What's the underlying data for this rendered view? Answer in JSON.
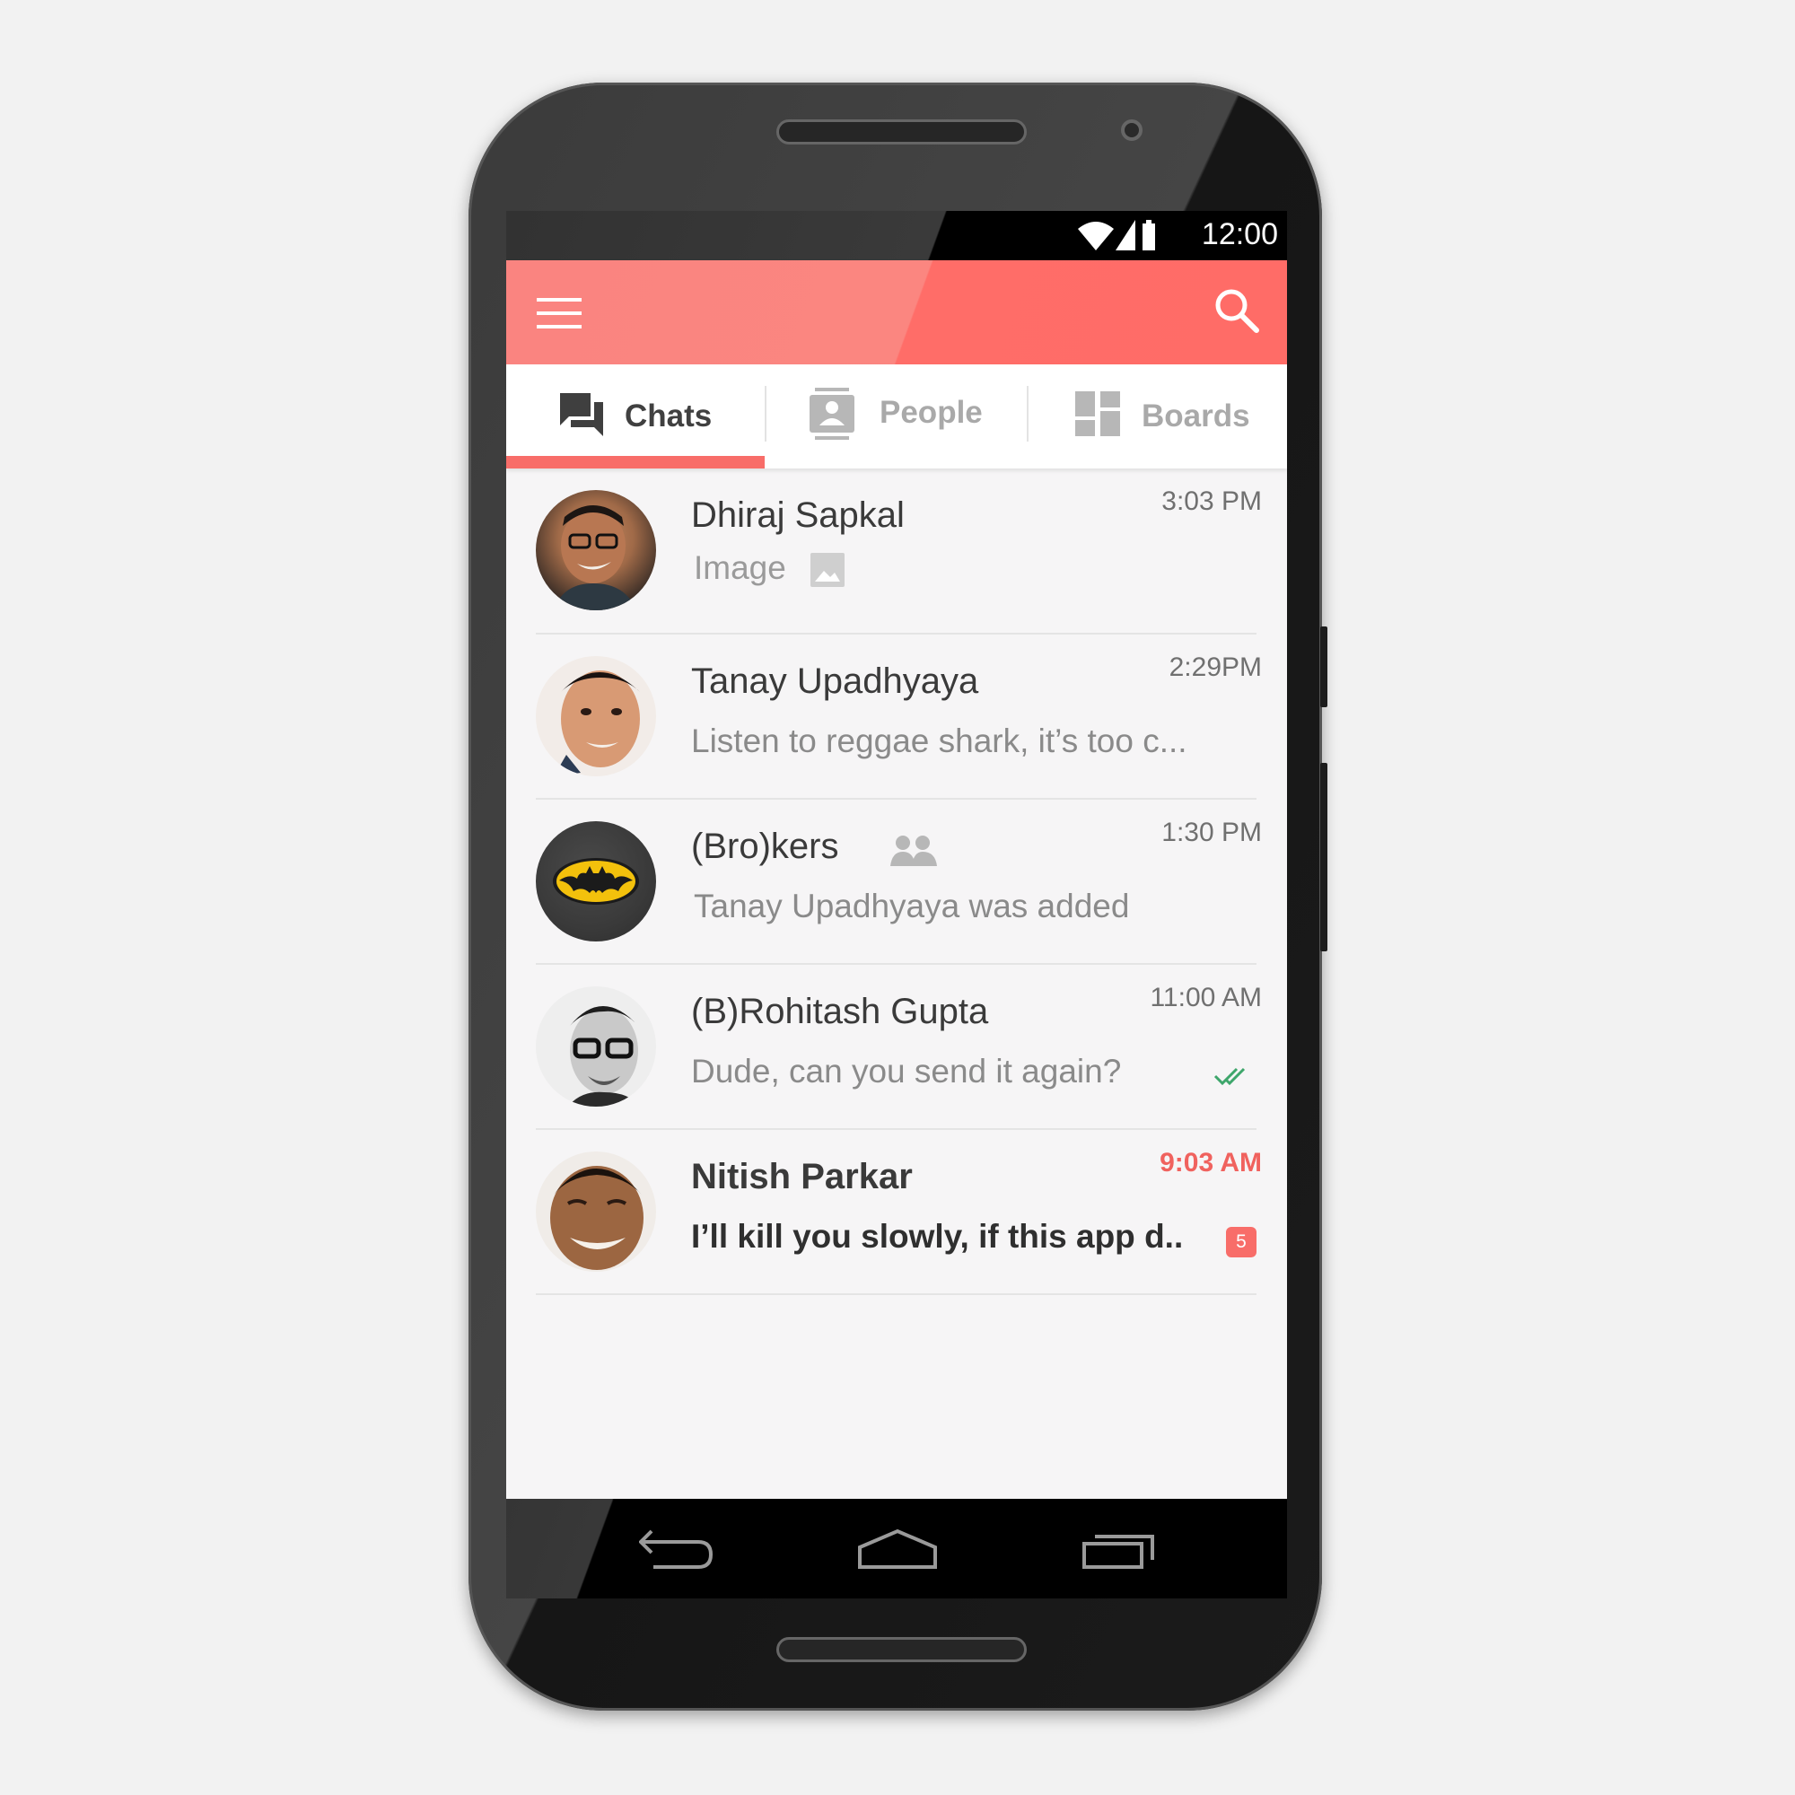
{
  "status_bar": {
    "time": "12:00",
    "icons": [
      "wifi-icon",
      "signal-icon",
      "battery-icon"
    ]
  },
  "app_bar": {
    "menu_icon": "menu-icon",
    "search_icon": "search-icon",
    "color": "#fb847f"
  },
  "tabs": [
    {
      "label": "Chats",
      "icon": "chat-bubbles-icon",
      "active": true
    },
    {
      "label": "People",
      "icon": "contact-card-icon",
      "active": false
    },
    {
      "label": "Boards",
      "icon": "dashboard-icon",
      "active": false
    }
  ],
  "chats": [
    {
      "name": "Dhiraj Sapkal",
      "message": "Image",
      "time": "3:03 PM",
      "attachment_icon": "image-icon"
    },
    {
      "name": "Tanay Upadhyaya",
      "message": "Listen to reggae shark, it’s too c...",
      "time": "2:29PM"
    },
    {
      "name": "(Bro)kers",
      "message": "Tanay Upadhyaya was added",
      "time": "1:30 PM",
      "group_icon": "group-icon"
    },
    {
      "name": "(B)Rohitash Gupta",
      "message": "Dude, can you send it again?",
      "time": "11:00 AM",
      "status_icon": "double-check-icon"
    },
    {
      "name": "Nitish Parkar",
      "message": "I’ll kill you slowly, if this app d..",
      "time": "9:03 AM",
      "unread_count": "5",
      "unread": true
    }
  ],
  "colors": {
    "accent": "#f86d69",
    "unread_time": "#f0625e",
    "read_check": "#3ea66b"
  },
  "nav_bar": {
    "icons": [
      "back-icon",
      "home-icon",
      "recents-icon"
    ]
  }
}
